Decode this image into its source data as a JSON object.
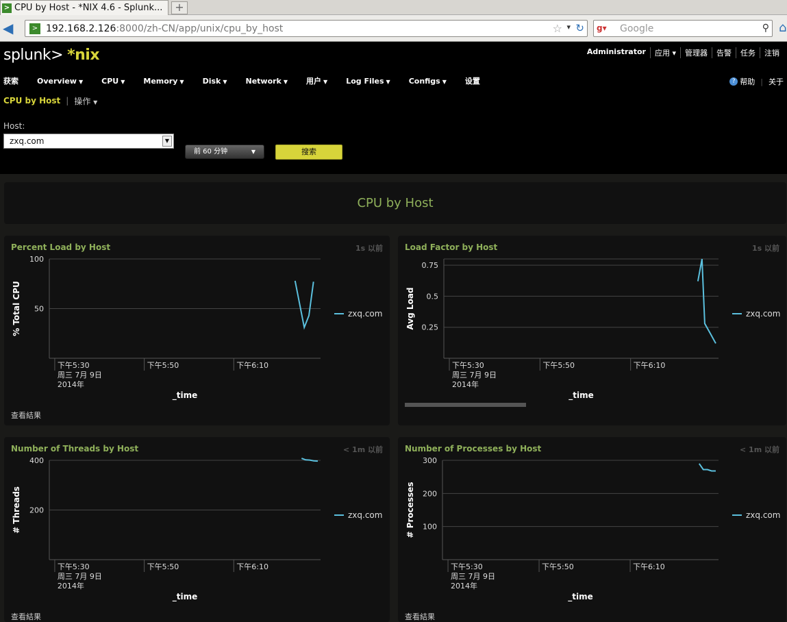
{
  "browser": {
    "tab_title": "CPU by Host - *NIX 4.6 - Splunk...",
    "url_host": "192.168.2.126",
    "url_rest": ":8000/zh-CN/app/unix/cpu_by_host",
    "search_placeholder": "Google"
  },
  "app": {
    "logo_main": "splunk>",
    "logo_app": "*nix",
    "user_menu": [
      "Administrator",
      "应用 ▾",
      "管理器",
      "告警",
      "任务",
      "注销"
    ],
    "nav": [
      "获索",
      "Overview",
      "CPU",
      "Memory",
      "Disk",
      "Network",
      "用户",
      "Log Files",
      "Configs",
      "设置"
    ],
    "help": "帮助",
    "about": "关于"
  },
  "subnav": {
    "crumb": "CPU by Host",
    "actions": "操作"
  },
  "controls": {
    "host_label": "Host:",
    "host_value": "zxq.com",
    "time_range": "前 60 分钟",
    "search_button": "搜索"
  },
  "page_title": "CPU by Host",
  "panels": [
    {
      "title": "Percent Load by Host",
      "age": "1s 以前",
      "ylabel": "% Total CPU",
      "xlabel": "_time",
      "footer": "查看結果"
    },
    {
      "title": "Load Factor by Host",
      "age": "1s 以前",
      "ylabel": "Avg Load",
      "xlabel": "_time",
      "footer": ""
    },
    {
      "title": "Number of Threads by Host",
      "age": "< 1m 以前",
      "ylabel": "# Threads",
      "xlabel": "_time",
      "footer": "查看結果"
    },
    {
      "title": "Number of Processes by Host",
      "age": "< 1m 以前",
      "ylabel": "# Processes",
      "xlabel": "_time",
      "footer": "查看結果"
    }
  ],
  "x_ticks": [
    {
      "label": [
        "下午5:30",
        "周三 7月 9日",
        "2014年"
      ]
    },
    {
      "label": [
        "下午5:50"
      ]
    },
    {
      "label": [
        "下午6:10"
      ]
    }
  ],
  "chart_data": [
    {
      "type": "line",
      "title": "Percent Load by Host",
      "ylabel": "% Total CPU",
      "xlabel": "_time",
      "ylim": [
        0,
        100
      ],
      "yticks": [
        50,
        100
      ],
      "grid": true,
      "legend": "right",
      "series": [
        {
          "name": "zxq.com",
          "color": "#5bc0de",
          "x": [
            0.906,
            0.94,
            0.957,
            0.974
          ],
          "values": [
            78,
            31,
            43,
            77
          ]
        }
      ]
    },
    {
      "type": "line",
      "title": "Load Factor by Host",
      "ylabel": "Avg Load",
      "xlabel": "_time",
      "ylim": [
        0,
        0.8
      ],
      "yticks": [
        0.25,
        0.5,
        0.75
      ],
      "grid": true,
      "legend": "right",
      "series": [
        {
          "name": "zxq.com",
          "color": "#5bc0de",
          "x": [
            0.925,
            0.94,
            0.95,
            0.97,
            0.99
          ],
          "values": [
            0.62,
            0.8,
            0.28,
            0.2,
            0.12
          ]
        }
      ]
    },
    {
      "type": "line",
      "title": "Number of Threads by Host",
      "ylabel": "# Threads",
      "xlabel": "_time",
      "ylim": [
        0,
        400
      ],
      "yticks": [
        200,
        400
      ],
      "grid": true,
      "legend": "right",
      "series": [
        {
          "name": "zxq.com",
          "color": "#5bc0de",
          "x": [
            0.93,
            0.945,
            0.96,
            0.975,
            0.99
          ],
          "values": [
            408,
            402,
            401,
            398,
            397
          ]
        }
      ]
    },
    {
      "type": "line",
      "title": "Number of Processes by Host",
      "ylabel": "# Processes",
      "xlabel": "_time",
      "ylim": [
        0,
        300
      ],
      "yticks": [
        100,
        200,
        300
      ],
      "grid": true,
      "legend": "right",
      "series": [
        {
          "name": "zxq.com",
          "color": "#5bc0de",
          "x": [
            0.93,
            0.945,
            0.96,
            0.975,
            0.99
          ],
          "values": [
            290,
            272,
            272,
            268,
            268
          ]
        }
      ]
    }
  ],
  "legend_label": "zxq.com"
}
